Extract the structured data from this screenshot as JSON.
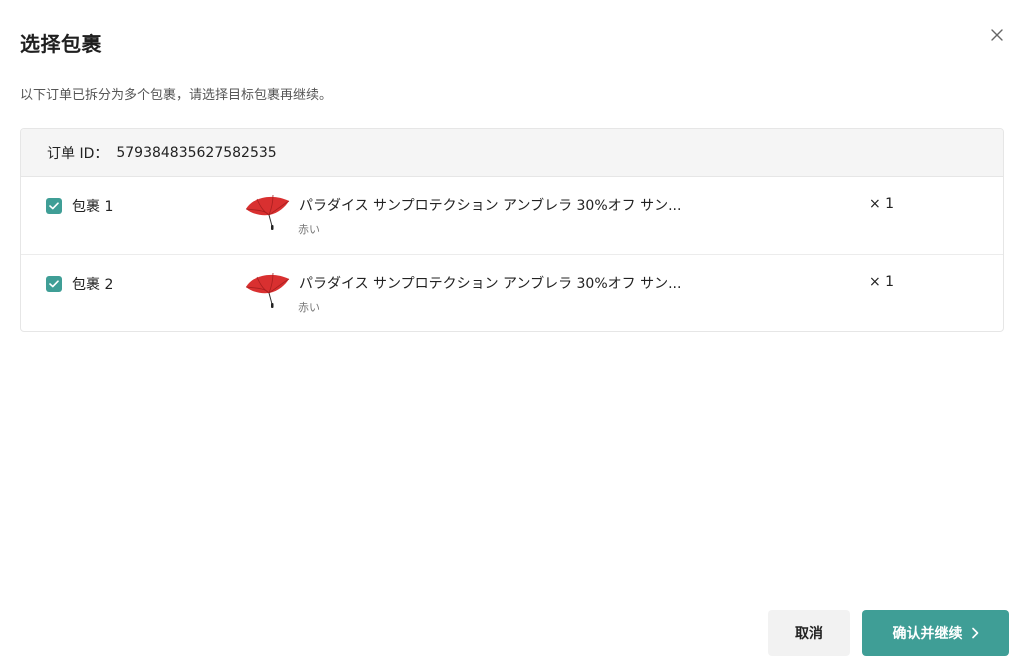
{
  "dialog": {
    "title": "选择包裹",
    "description": "以下订单已拆分为多个包裹，请选择目标包裹再继续。"
  },
  "order": {
    "id_label": "订单 ID：",
    "id_value": "579384835627582535"
  },
  "packages": [
    {
      "name": "包裹 1",
      "checked": true,
      "product_title": "パラダイス サンプロテクション アンブレラ 30%オフ サン...",
      "variant": "赤い",
      "quantity": "× 1"
    },
    {
      "name": "包裹 2",
      "checked": true,
      "product_title": "パラダイス サンプロテクション アンブレラ 30%オフ サン...",
      "variant": "赤い",
      "quantity": "× 1"
    }
  ],
  "footer": {
    "cancel_label": "取消",
    "confirm_label": "确认并继续"
  },
  "colors": {
    "accent": "#3f9e96",
    "header_bg": "#f5f5f5",
    "umbrella": "#d93030"
  },
  "icons": {
    "close": "close-icon",
    "check": "check-icon",
    "arrow": "chevron-right-icon",
    "thumbnail": "umbrella-thumbnail"
  }
}
